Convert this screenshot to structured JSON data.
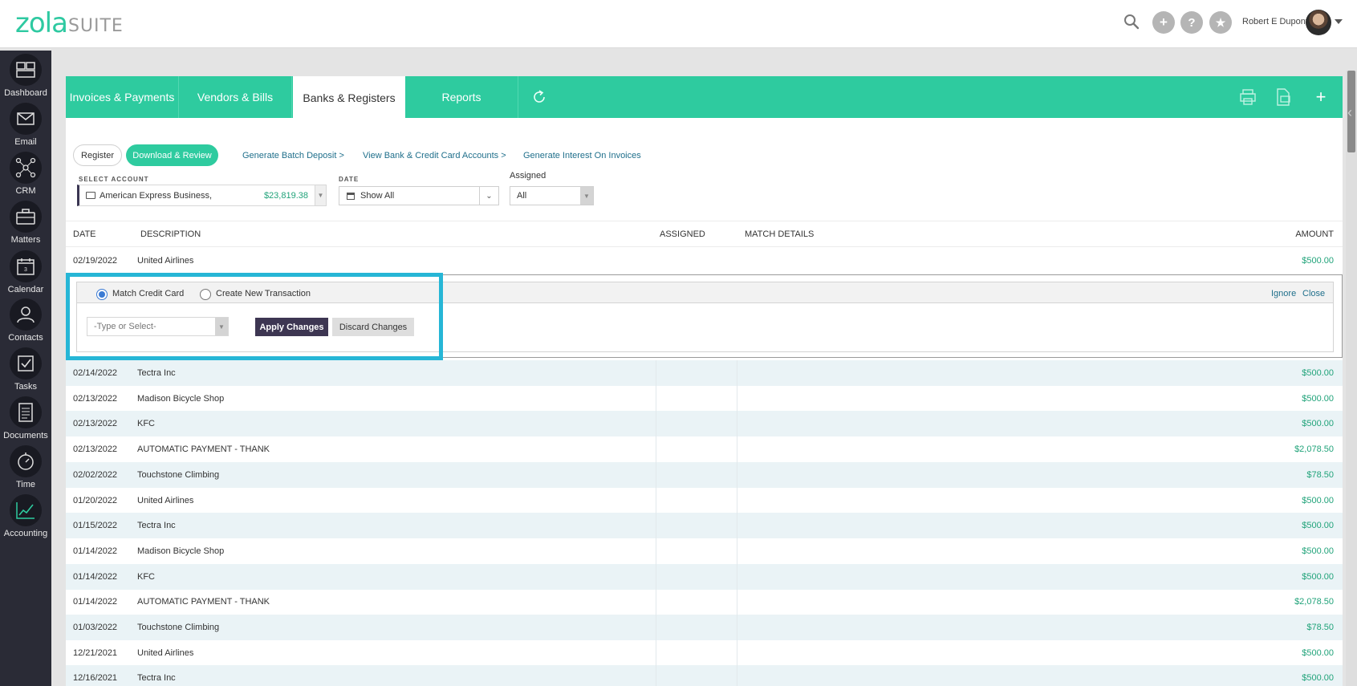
{
  "header": {
    "logo_primary": "zola",
    "logo_secondary": "SUITE",
    "user_name": "Robert E Dupont",
    "icons": [
      "search-icon",
      "plus-icon",
      "help-icon",
      "star-icon"
    ]
  },
  "sidebar": {
    "items": [
      {
        "label": "Dashboard",
        "icon": "dashboard-icon"
      },
      {
        "label": "Email",
        "icon": "email-icon"
      },
      {
        "label": "CRM",
        "icon": "crm-network-icon"
      },
      {
        "label": "Matters",
        "icon": "briefcase-icon"
      },
      {
        "label": "Calendar",
        "icon": "calendar-icon"
      },
      {
        "label": "Contacts",
        "icon": "contacts-icon"
      },
      {
        "label": "Tasks",
        "icon": "checkbox-icon"
      },
      {
        "label": "Documents",
        "icon": "document-icon"
      },
      {
        "label": "Time",
        "icon": "stopwatch-icon"
      },
      {
        "label": "Accounting",
        "icon": "chart-icon"
      }
    ],
    "calendar_day": "3"
  },
  "tabs": [
    {
      "label": "Invoices & Payments"
    },
    {
      "label": "Vendors & Bills"
    },
    {
      "label": "Banks & Registers"
    },
    {
      "label": "Reports"
    }
  ],
  "toolbar": {
    "register": "Register",
    "download_review": "Download & Review",
    "links": [
      "Generate Batch Deposit >",
      "View Bank & Credit Card Accounts >",
      "Generate Interest On Invoices"
    ]
  },
  "filters": {
    "account_label": "SELECT ACCOUNT",
    "account_name": "American Express Business,",
    "account_balance": "$23,819.38",
    "date_label": "DATE",
    "date_value": "Show All",
    "assigned_label": "Assigned",
    "assigned_value": "All"
  },
  "table": {
    "headers": {
      "date": "DATE",
      "description": "DESCRIPTION",
      "assigned": "ASSIGNED",
      "match_details": "MATCH DETAILS",
      "amount": "AMOUNT"
    },
    "first_row": {
      "date": "02/19/2022",
      "description": "United Airlines",
      "amount": "$500.00"
    },
    "rows": [
      {
        "date": "02/14/2022",
        "description": "Tectra Inc",
        "amount": "$500.00"
      },
      {
        "date": "02/13/2022",
        "description": "Madison Bicycle Shop",
        "amount": "$500.00"
      },
      {
        "date": "02/13/2022",
        "description": "KFC",
        "amount": "$500.00"
      },
      {
        "date": "02/13/2022",
        "description": "AUTOMATIC PAYMENT - THANK",
        "amount": "$2,078.50"
      },
      {
        "date": "02/02/2022",
        "description": "Touchstone Climbing",
        "amount": "$78.50"
      },
      {
        "date": "01/20/2022",
        "description": "United Airlines",
        "amount": "$500.00"
      },
      {
        "date": "01/15/2022",
        "description": "Tectra Inc",
        "amount": "$500.00"
      },
      {
        "date": "01/14/2022",
        "description": "Madison Bicycle Shop",
        "amount": "$500.00"
      },
      {
        "date": "01/14/2022",
        "description": "KFC",
        "amount": "$500.00"
      },
      {
        "date": "01/14/2022",
        "description": "AUTOMATIC PAYMENT - THANK",
        "amount": "$2,078.50"
      },
      {
        "date": "01/03/2022",
        "description": "Touchstone Climbing",
        "amount": "$78.50"
      },
      {
        "date": "12/21/2021",
        "description": "United Airlines",
        "amount": "$500.00"
      },
      {
        "date": "12/16/2021",
        "description": "Tectra Inc",
        "amount": "$500.00"
      }
    ]
  },
  "match_panel": {
    "option_match": "Match Credit Card",
    "option_create": "Create New Transaction",
    "ignore": "Ignore",
    "close": "Close",
    "select_placeholder": "-Type or Select-",
    "apply": "Apply Changes",
    "discard": "Discard Changes"
  },
  "colors": {
    "brand": "#2ecb9f",
    "sidebar": "#2a2b36",
    "highlight": "#26b6d6",
    "amount": "#21a37a"
  }
}
